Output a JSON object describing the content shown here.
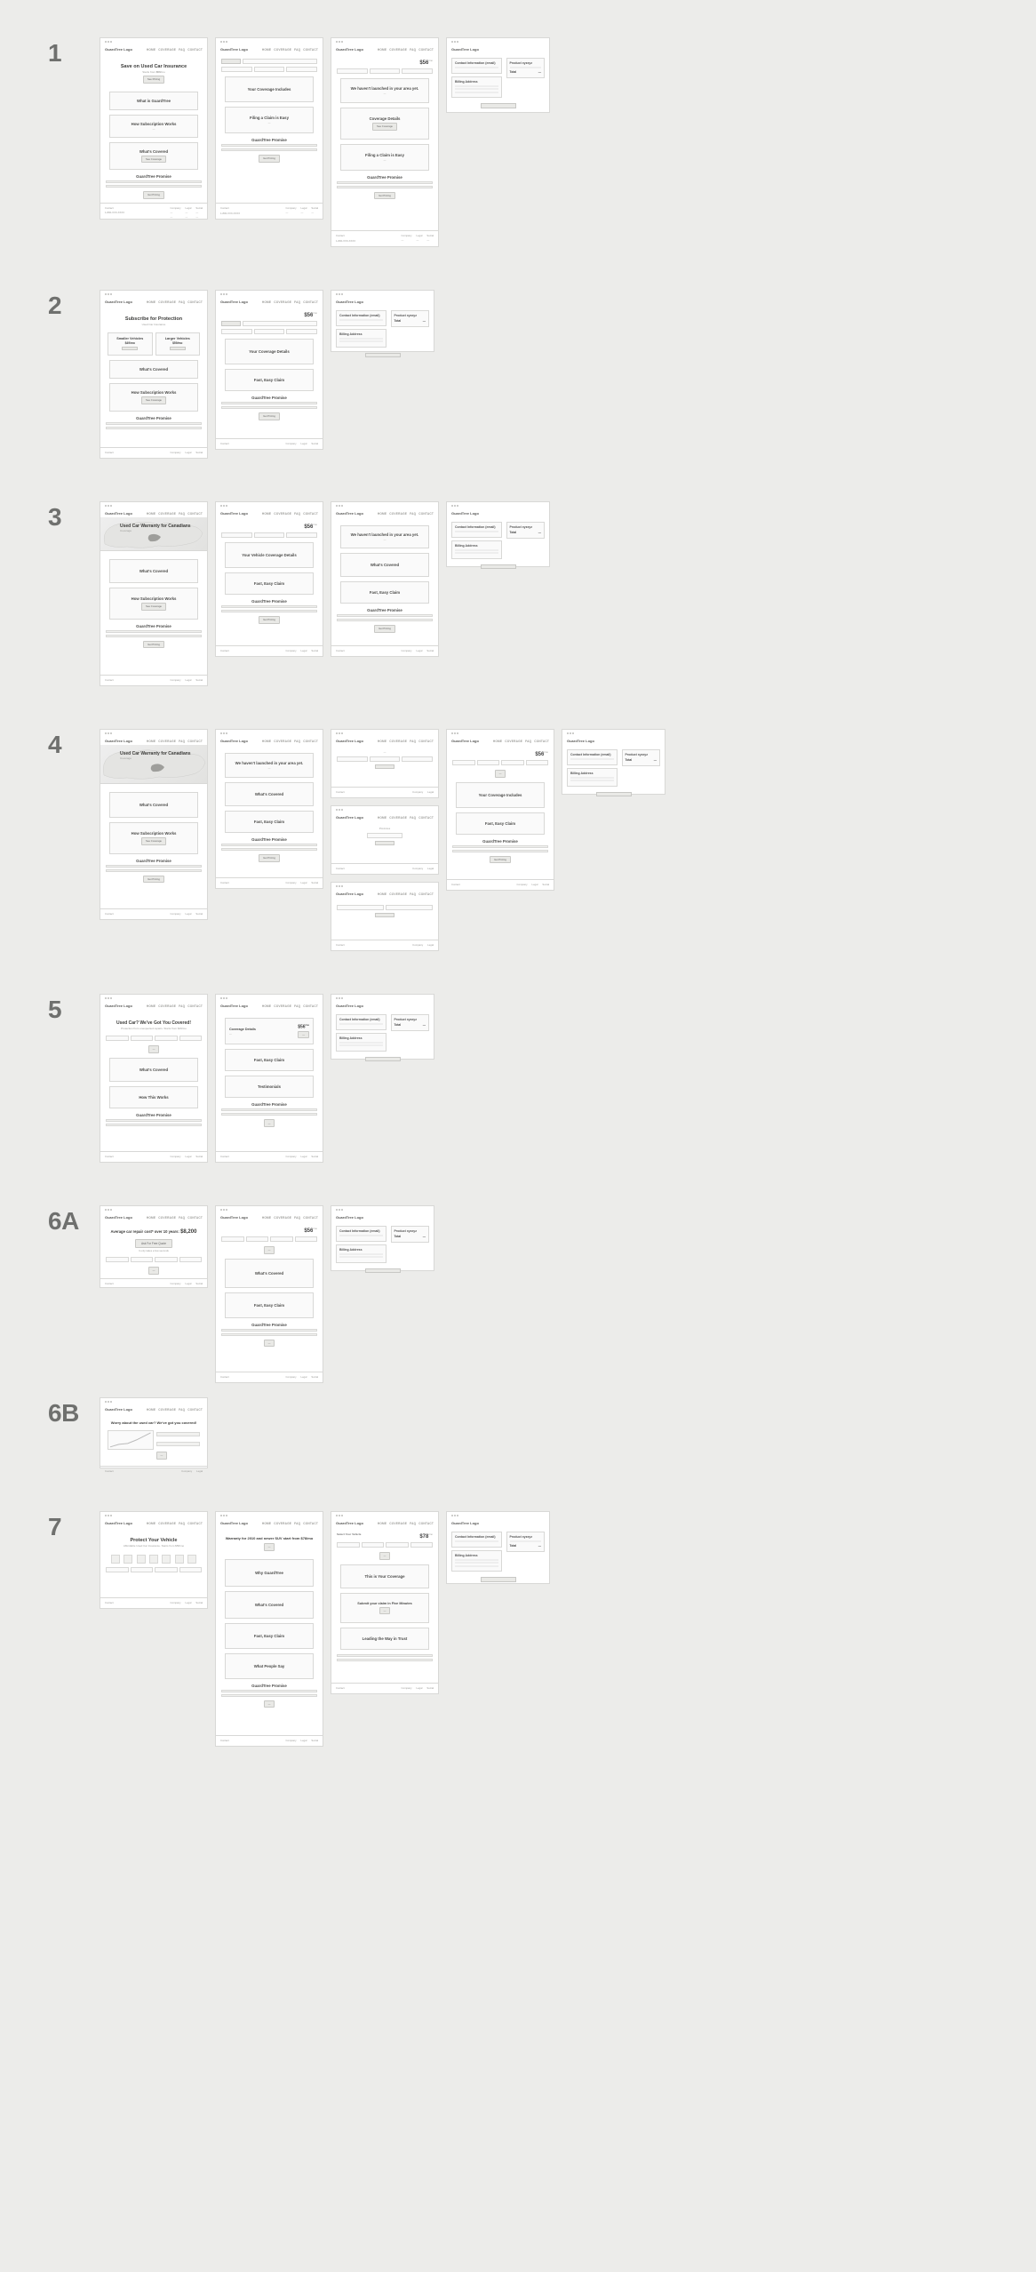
{
  "rows": [
    "1",
    "2",
    "3",
    "4",
    "5",
    "6A",
    "6B",
    "7"
  ],
  "brand": "GuardTree Logo",
  "nav": [
    "HOME",
    "COVERAGE",
    "FAQ",
    "CONTACT"
  ],
  "promise": "GuardTree Promise",
  "whats_covered": "What's Covered",
  "how_sub": "How Subscription Works",
  "fast_claim": "Fast, Easy Claim",
  "filing": "Filing a Claim is Easy",
  "not_launched": "We haven't launched in your area yet.",
  "see_coverage": "See Coverage",
  "get_pricing": "Get Pricing",
  "learn_cta": "See Pricing",
  "row1": {
    "s1": {
      "title": "Save on Used Car Insurance",
      "sub": "Starts from",
      "price": "$56",
      "per": "/mo",
      "c1": "What is GuardTree"
    },
    "s2": {
      "pill": "All Vehicles",
      "f1": "Year",
      "f2": "Make",
      "f3": "Model",
      "c1": "Your Coverage Includes"
    },
    "s3": {
      "price": "$56",
      "per": "/mo",
      "c1": "Coverage Details"
    }
  },
  "row2": {
    "s1": {
      "title": "Subscribe for Protection",
      "sub": "Used Car Insurance",
      "left_t": "Smaller Vehicles",
      "left_p": "$49/mo",
      "right_t": "Larger Vehicles",
      "right_p": "$59/mo"
    },
    "s2": {
      "price": "$56",
      "per": "/mo",
      "c1": "Your Coverage Details"
    }
  },
  "row3": {
    "s1": {
      "title": "Used Car Warranty for Canadians",
      "sub": "Coverage"
    },
    "s2": {
      "price": "$56",
      "per": "/mo",
      "c1": "Your Vehicle Coverage Details"
    }
  },
  "row4": {
    "s1": {
      "title": "Used Car Warranty for Canadians",
      "sub": "Coverage"
    },
    "s5": {
      "price": "$56",
      "per": "/mo",
      "f1": "Year",
      "f2": "Make",
      "f3": "Model",
      "f4": "Province",
      "c1": "Your Coverage Includes"
    },
    "step": {
      "f1": "Year",
      "f2": "Make",
      "f3": "Model",
      "label": "Provinces"
    }
  },
  "row5": {
    "s1": {
      "title": "Used Car? We've Got You Covered!",
      "sub": "Protection from unexpected repairs. Starts from $49/mo",
      "c1": "How This Works"
    },
    "s2": {
      "c1": "Coverage Details",
      "price": "$56",
      "per": "/mo",
      "c2": "Testimonials"
    }
  },
  "row6a": {
    "s1": {
      "title": "Average car repair cost* over 10 years:",
      "price": "$8,200",
      "cta": "Ask For Free Quote",
      "sub": "It only takes a few seconds"
    },
    "s2": {
      "price": "$56",
      "per": "/mo"
    }
  },
  "row6b": {
    "s1": {
      "title": "Worry about the used car? We've got you covered!"
    }
  },
  "row7": {
    "s1": {
      "title": "Protect Your Vehicle",
      "sub": "Affordable Used Car Insurance. Starts from $56/mo"
    },
    "s2": {
      "title": "Warranty for 2010 and newer SUV start from $78/mo",
      "c1": "Why GuardTree",
      "c2": "What People Say"
    },
    "s3": {
      "title": "Select Your Vehicle",
      "price": "$78",
      "per": "/mo",
      "c1": "This is Your Coverage",
      "c2": "Submit your claim in Five Minutes",
      "c3": "Leading the Way in Trust"
    }
  },
  "chk": {
    "contact": "Contact Information (email)",
    "billing": "Billing Address",
    "product": "Product xyzxyz",
    "total": "Total",
    "btn": "Complete Purchase"
  },
  "ftr": {
    "l1": "Contact",
    "l2": "1-800-XXX-XXXX",
    "c1": "Company",
    "c2": "Legal",
    "c3": "Social"
  }
}
